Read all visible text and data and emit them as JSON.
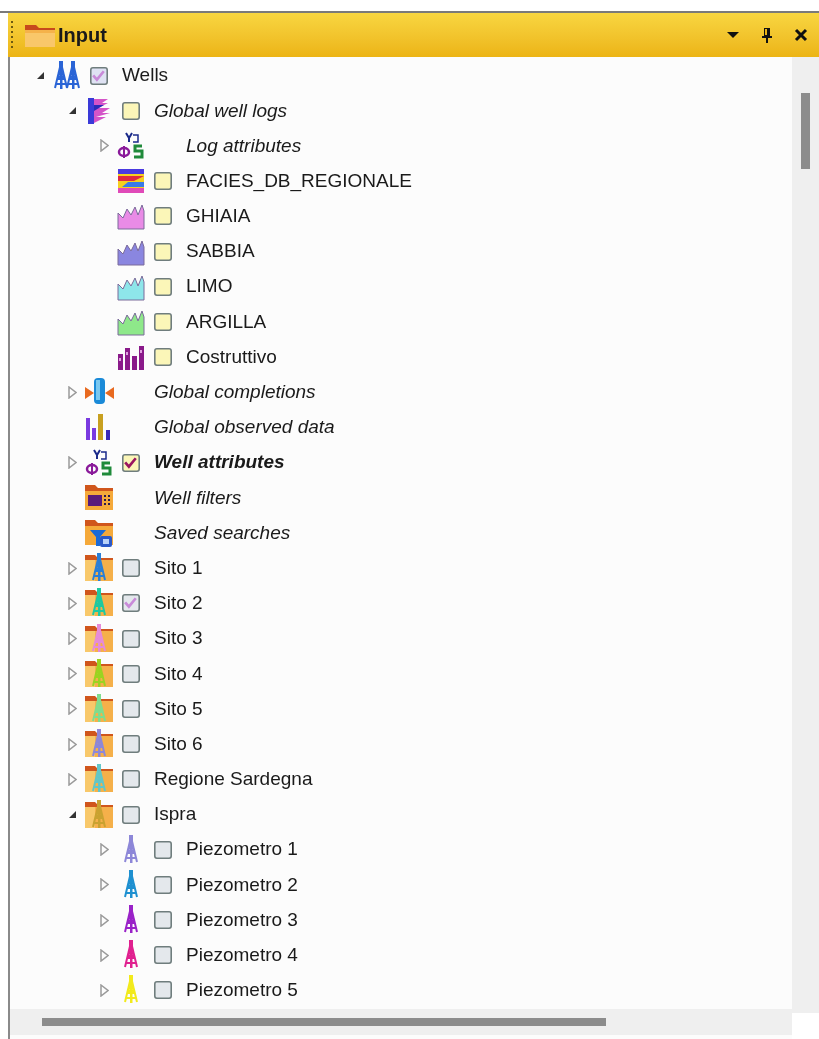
{
  "panel": {
    "title": "Input"
  },
  "tree": [
    {
      "label": "Wells",
      "kind": "wells",
      "expanded": true,
      "checked": true,
      "partial": true,
      "children": [
        {
          "label": "Global well logs",
          "kind": "logs",
          "expanded": true,
          "checked": false,
          "children": [
            {
              "label": "Log attributes",
              "kind": "log_attributes",
              "expanded": false
            },
            {
              "label": "FACIES_DB_REGIONALE",
              "kind": "facies",
              "checked": false
            },
            {
              "label": "GHIAIA",
              "kind": "curve",
              "color": "#e98be6",
              "checked": false
            },
            {
              "label": "SABBIA",
              "kind": "curve",
              "color": "#8a86e0",
              "checked": false
            },
            {
              "label": "LIMO",
              "kind": "curve",
              "color": "#8ee6ea",
              "checked": false
            },
            {
              "label": "ARGILLA",
              "kind": "curve",
              "color": "#8ee88a",
              "checked": false
            },
            {
              "label": "Costruttivo",
              "kind": "bars",
              "checked": false
            }
          ]
        },
        {
          "label": "Global completions",
          "kind": "completions",
          "expanded": false
        },
        {
          "label": "Global observed data",
          "kind": "observed"
        },
        {
          "label": "Well attributes",
          "kind": "well_attributes",
          "expanded": false,
          "checked": true,
          "partial": false
        },
        {
          "label": "Well filters",
          "kind": "filters"
        },
        {
          "label": "Saved searches",
          "kind": "searches"
        },
        {
          "label": "Sito 1",
          "kind": "folder",
          "color": "#2a7fd6",
          "expanded": false,
          "checked": false
        },
        {
          "label": "Sito 2",
          "kind": "folder",
          "color": "#1fc9a0",
          "expanded": false,
          "checked": true,
          "partial": true
        },
        {
          "label": "Sito 3",
          "kind": "folder",
          "color": "#e58bd8",
          "expanded": false,
          "checked": false
        },
        {
          "label": "Sito 4",
          "kind": "folder",
          "color": "#9bd321",
          "expanded": false,
          "checked": false
        },
        {
          "label": "Sito 5",
          "kind": "folder",
          "color": "#7fdc8e",
          "expanded": false,
          "checked": false
        },
        {
          "label": "Sito 6",
          "kind": "folder",
          "color": "#8d87d8",
          "expanded": false,
          "checked": false
        },
        {
          "label": "Regione Sardegna",
          "kind": "folder",
          "color": "#62c6c8",
          "expanded": false,
          "checked": false
        },
        {
          "label": "Ispra",
          "kind": "folder",
          "color": "#c9a230",
          "expanded": true,
          "checked": false,
          "children": [
            {
              "label": "Piezometro 1",
              "kind": "well",
              "color": "#8d87d8",
              "expanded": false,
              "checked": false
            },
            {
              "label": "Piezometro 2",
              "kind": "well",
              "color": "#1e90d0",
              "expanded": false,
              "checked": false
            },
            {
              "label": "Piezometro 3",
              "kind": "well",
              "color": "#9a22c8",
              "expanded": false,
              "checked": false
            },
            {
              "label": "Piezometro 4",
              "kind": "well",
              "color": "#e0208f",
              "expanded": false,
              "checked": false
            },
            {
              "label": "Piezometro 5",
              "kind": "well",
              "color": "#f2ea1c",
              "expanded": false,
              "checked": false
            }
          ]
        }
      ]
    }
  ]
}
